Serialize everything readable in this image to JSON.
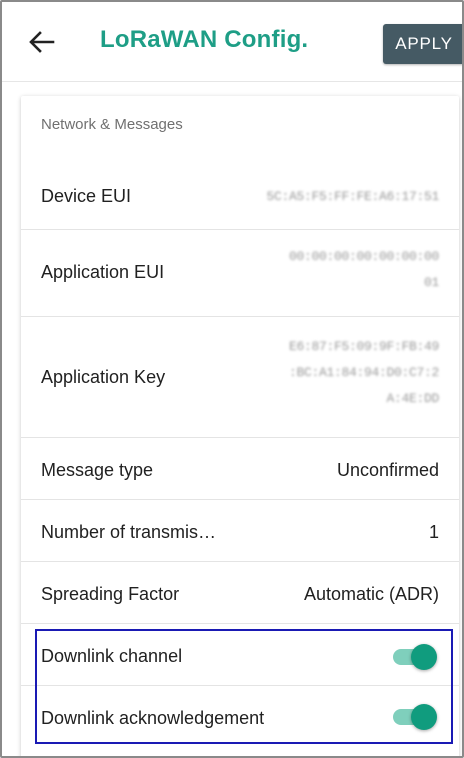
{
  "appbar": {
    "back_icon": "arrow-left-icon",
    "title": "LoRaWAN Config.",
    "apply_label": "APPLY",
    "title_color": "#1e9e86",
    "apply_bg": "#455a64"
  },
  "section": {
    "label": "Network & Messages"
  },
  "rows": {
    "device_eui": {
      "label": "Device EUI",
      "value": "5C:A5:F5:FF:FE:A6:17:51"
    },
    "application_eui": {
      "label": "Application EUI",
      "value_line1": "00:00:00:00:00:00:00",
      "value_line2": "01"
    },
    "application_key": {
      "label": "Application Key",
      "value_line1": "E6:87:F5:09:9F:FB:49",
      "value_line2": ":BC:A1:84:94:D0:C7:2",
      "value_line3": "A:4E:DD"
    },
    "message_type": {
      "label": "Message type",
      "value": "Unconfirmed"
    },
    "transmissions": {
      "label": "Number of transmis…",
      "value": "1"
    },
    "spreading_factor": {
      "label": "Spreading Factor",
      "value": "Automatic (ADR)"
    },
    "downlink_channel": {
      "label": "Downlink channel",
      "enabled": true
    },
    "downlink_ack": {
      "label": "Downlink acknowledgement",
      "enabled": true
    }
  },
  "colors": {
    "toggle_on": "#109c7e",
    "toggle_track": "#7fcfbc",
    "highlight": "#1a1ab4"
  }
}
